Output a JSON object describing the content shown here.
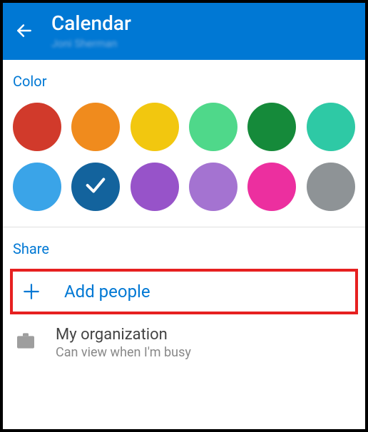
{
  "header": {
    "title": "Calendar",
    "subtitle": "Joni Sherman"
  },
  "sections": {
    "color_label": "Color",
    "share_label": "Share"
  },
  "colors": [
    {
      "name": "red",
      "hex": "#d13a2b",
      "selected": false
    },
    {
      "name": "orange",
      "hex": "#f08b1d",
      "selected": false
    },
    {
      "name": "yellow",
      "hex": "#f2c70f",
      "selected": false
    },
    {
      "name": "light-green",
      "hex": "#4fd88a",
      "selected": false
    },
    {
      "name": "dark-green",
      "hex": "#158a3a",
      "selected": false
    },
    {
      "name": "teal",
      "hex": "#2ec9a5",
      "selected": false
    },
    {
      "name": "light-blue",
      "hex": "#3aa4e8",
      "selected": false
    },
    {
      "name": "dark-blue",
      "hex": "#13639d",
      "selected": true
    },
    {
      "name": "purple",
      "hex": "#9753c9",
      "selected": false
    },
    {
      "name": "light-purple",
      "hex": "#a473d1",
      "selected": false
    },
    {
      "name": "pink",
      "hex": "#ec2f9f",
      "selected": false
    },
    {
      "name": "gray",
      "hex": "#8e9396",
      "selected": false
    }
  ],
  "share": {
    "add_people_label": "Add people",
    "org_title": "My organization",
    "org_subtitle": "Can view when I'm busy"
  }
}
